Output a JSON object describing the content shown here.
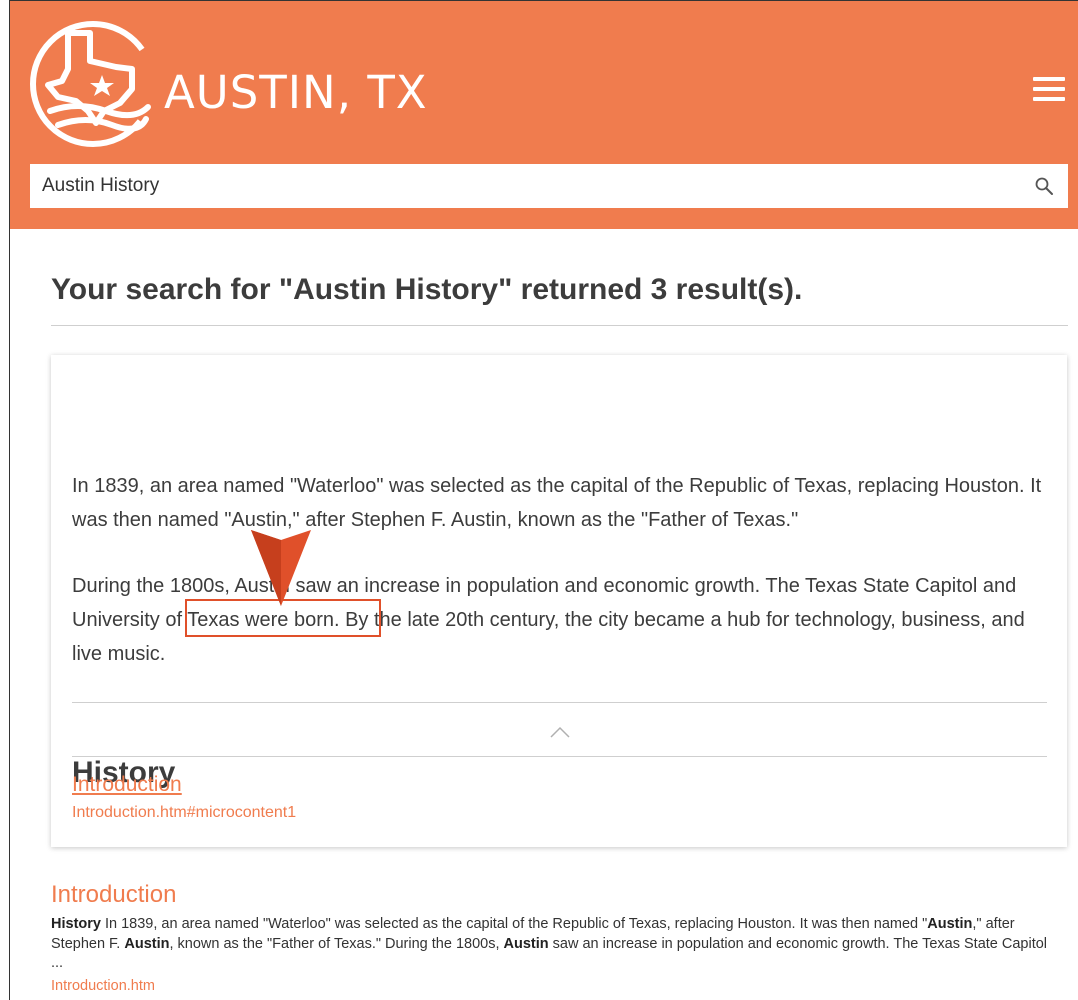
{
  "header": {
    "brand": "AUSTIN, TX",
    "colors": {
      "brand_orange": "#f07c4e",
      "marker_red": "#e0502a"
    },
    "menu_icon": "hamburger-icon"
  },
  "search": {
    "value": "Austin History",
    "icon": "search-icon"
  },
  "results": {
    "heading": "Your search for \"Austin History\" returned 3 result(s).",
    "featured": {
      "title": "History",
      "paragraph1": "In 1839, an area named \"Waterloo\" was selected as the capital of the Republic of Texas, replacing Houston. It was then named \"Austin,\" after Stephen F. Austin, known as the \"Father of Texas.\"",
      "paragraph2_part1": "During the 1800s, Austin saw an increase in population and economic growth. The Texas State Capitol and ",
      "paragraph2_highlight": "University of Texas",
      "paragraph2_part2": " were born. By the late 20th century, the city became a hub for technology, business, and live music.",
      "link_label": "Introduction",
      "link_url": "Introduction.htm#microcontent1"
    },
    "items": [
      {
        "title": "Introduction",
        "snippet": {
          "s1": "History",
          "s2": " In 1839, an area named \"Waterloo\" was selected as the capital of the Republic of Texas, replacing Houston. It was then named \"",
          "s3": "Austin",
          "s4": ",\" after Stephen F. ",
          "s5": "Austin",
          "s6": ", known as the \"Father of Texas.\" During the 1800s, ",
          "s7": "Austin",
          "s8": " saw an increase in population and economic growth. The Texas State Capitol ..."
        },
        "url": "Introduction.htm"
      }
    ]
  }
}
